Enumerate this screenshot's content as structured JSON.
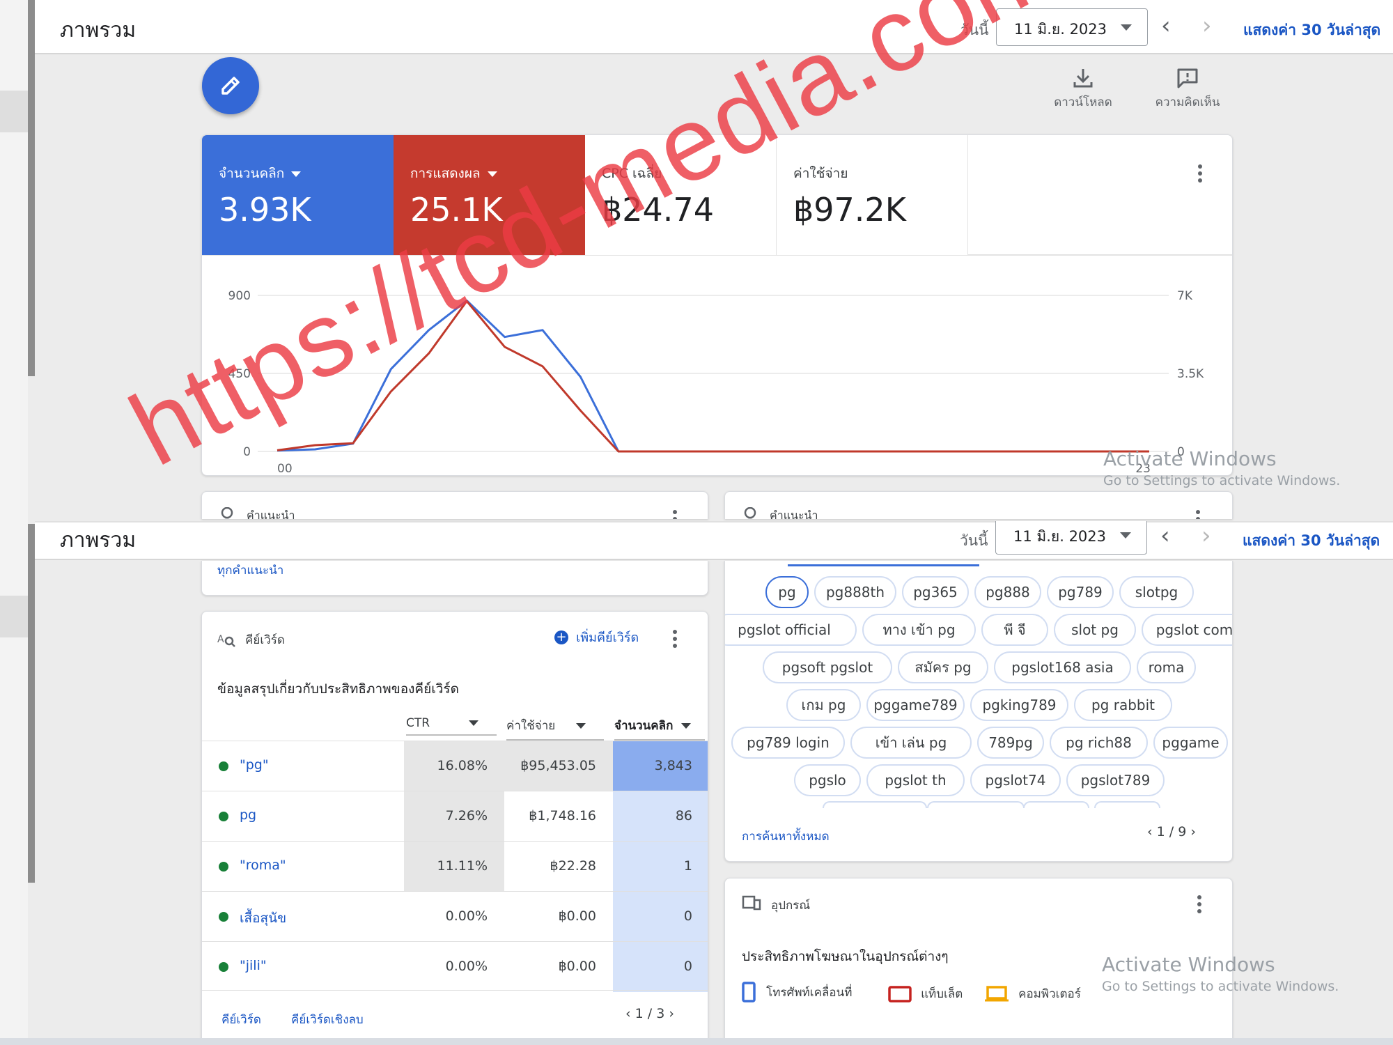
{
  "top": {
    "title": "ภาพรวม",
    "today_label": "วันนี้",
    "date": "11 มิ.ย. 2023",
    "show30": "แสดงค่า 30 วันล่าสุด",
    "download": "ดาวน์โหลด",
    "feedback": "ความคิดเห็น"
  },
  "metrics": [
    {
      "label": "จำนวนคลิก",
      "value": "3.93K",
      "color": "#3b6fd9"
    },
    {
      "label": "การแสดงผล",
      "value": "25.1K",
      "color": "#c53a2e"
    },
    {
      "label": "CPC เฉลี่ย",
      "value": "฿24.74"
    },
    {
      "label": "ค่าใช้จ่าย",
      "value": "฿97.2K"
    }
  ],
  "chart_data": {
    "type": "line",
    "x_ticks": [
      "00",
      "23"
    ],
    "y_left_ticks": [
      "900",
      "450",
      "0"
    ],
    "y_right_ticks": [
      "7K",
      "3.5K",
      "0"
    ],
    "ylim_left": [
      0,
      900
    ],
    "ylim_right": [
      0,
      7000
    ],
    "x": [
      0,
      1,
      2,
      3,
      4,
      5,
      6,
      7,
      8,
      9,
      10,
      11,
      12,
      13,
      14,
      15,
      16,
      17,
      18,
      19,
      20,
      21,
      22,
      23
    ],
    "series": [
      {
        "name": "จำนวนคลิก",
        "axis": "left",
        "color": "#3b6fd9",
        "values": [
          5,
          12,
          45,
          475,
          700,
          870,
          660,
          700,
          430,
          0,
          0,
          0,
          0,
          0,
          0,
          0,
          0,
          0,
          0,
          0,
          0,
          0,
          0,
          0
        ]
      },
      {
        "name": "การแสดงผล",
        "axis": "right",
        "color": "#c0392b",
        "values": [
          50,
          280,
          370,
          2690,
          4400,
          6740,
          4690,
          3820,
          1830,
          0,
          0,
          0,
          0,
          0,
          0,
          0,
          0,
          0,
          0,
          0,
          0,
          0,
          0,
          0
        ]
      }
    ]
  },
  "recommend": {
    "label": "คำแนะนำ",
    "all_link": "ทุกคำแนะนำ"
  },
  "second_header": {
    "title": "ภาพรวม",
    "today_label": "วันนี้",
    "date": "11 มิ.ย. 2023",
    "show30": "แสดงค่า 30 วันล่าสุด"
  },
  "keywords": {
    "title": "คีย์เวิร์ด",
    "add": "เพิ่มคีย์เวิร์ด",
    "subtitle": "ข้อมูลสรุปเกี่ยวกับประสิทธิภาพของคีย์เวิร์ด",
    "columns": [
      "CTR",
      "ค่าใช้จ่าย",
      "จำนวนคลิก"
    ],
    "rows": [
      {
        "name": "\"pg\"",
        "ctr": "16.08%",
        "cost": "฿95,453.05",
        "clicks": "3,843"
      },
      {
        "name": "pg",
        "ctr": "7.26%",
        "cost": "฿1,748.16",
        "clicks": "86"
      },
      {
        "name": "\"roma\"",
        "ctr": "11.11%",
        "cost": "฿22.28",
        "clicks": "1"
      },
      {
        "name": "เสื้อสุนัข",
        "ctr": "0.00%",
        "cost": "฿0.00",
        "clicks": "0"
      },
      {
        "name": "\"jili\"",
        "ctr": "0.00%",
        "cost": "฿0.00",
        "clicks": "0"
      }
    ],
    "footer_tab1": "คีย์เวิร์ด",
    "footer_tab2": "คีย์เวิร์ดเชิงลบ",
    "pager": "1 / 3"
  },
  "searches": {
    "chips": [
      "pg",
      "pg888th",
      "pg365",
      "pg888",
      "pg789",
      "slotpg",
      "pgslot official",
      "ทาง เข้า pg",
      "พี จี",
      "slot pg",
      "pgslot com",
      "pgsoft pgslot",
      "สมัคร pg",
      "pgslot168 asia",
      "roma",
      "เกม pg",
      "pggame789",
      "pgking789",
      "pg rabbit",
      "pg789 login",
      "เข้า เล่น pg",
      "789pg",
      "pg rich88",
      "pggame",
      "pgslo",
      "pgslot th",
      "pgslot74",
      "pgslot789"
    ],
    "all_link": "การค้นหาทั้งหมด",
    "pager": "1 / 9"
  },
  "devices": {
    "title": "อุปกรณ์",
    "subtitle": "ประสิทธิภาพโฆษณาในอุปกรณ์ต่างๆ",
    "legend": [
      {
        "label": "โทรศัพท์เคลื่อนที่",
        "color": "#3b6fd9"
      },
      {
        "label": "แท็บเล็ต",
        "color": "#c5221f"
      },
      {
        "label": "คอมพิวเตอร์",
        "color": "#f2a600"
      }
    ]
  },
  "activate": {
    "line1": "Activate Windows",
    "line2": "Go to Settings to activate Windows."
  },
  "watermark": "https://tcd-media.com/"
}
